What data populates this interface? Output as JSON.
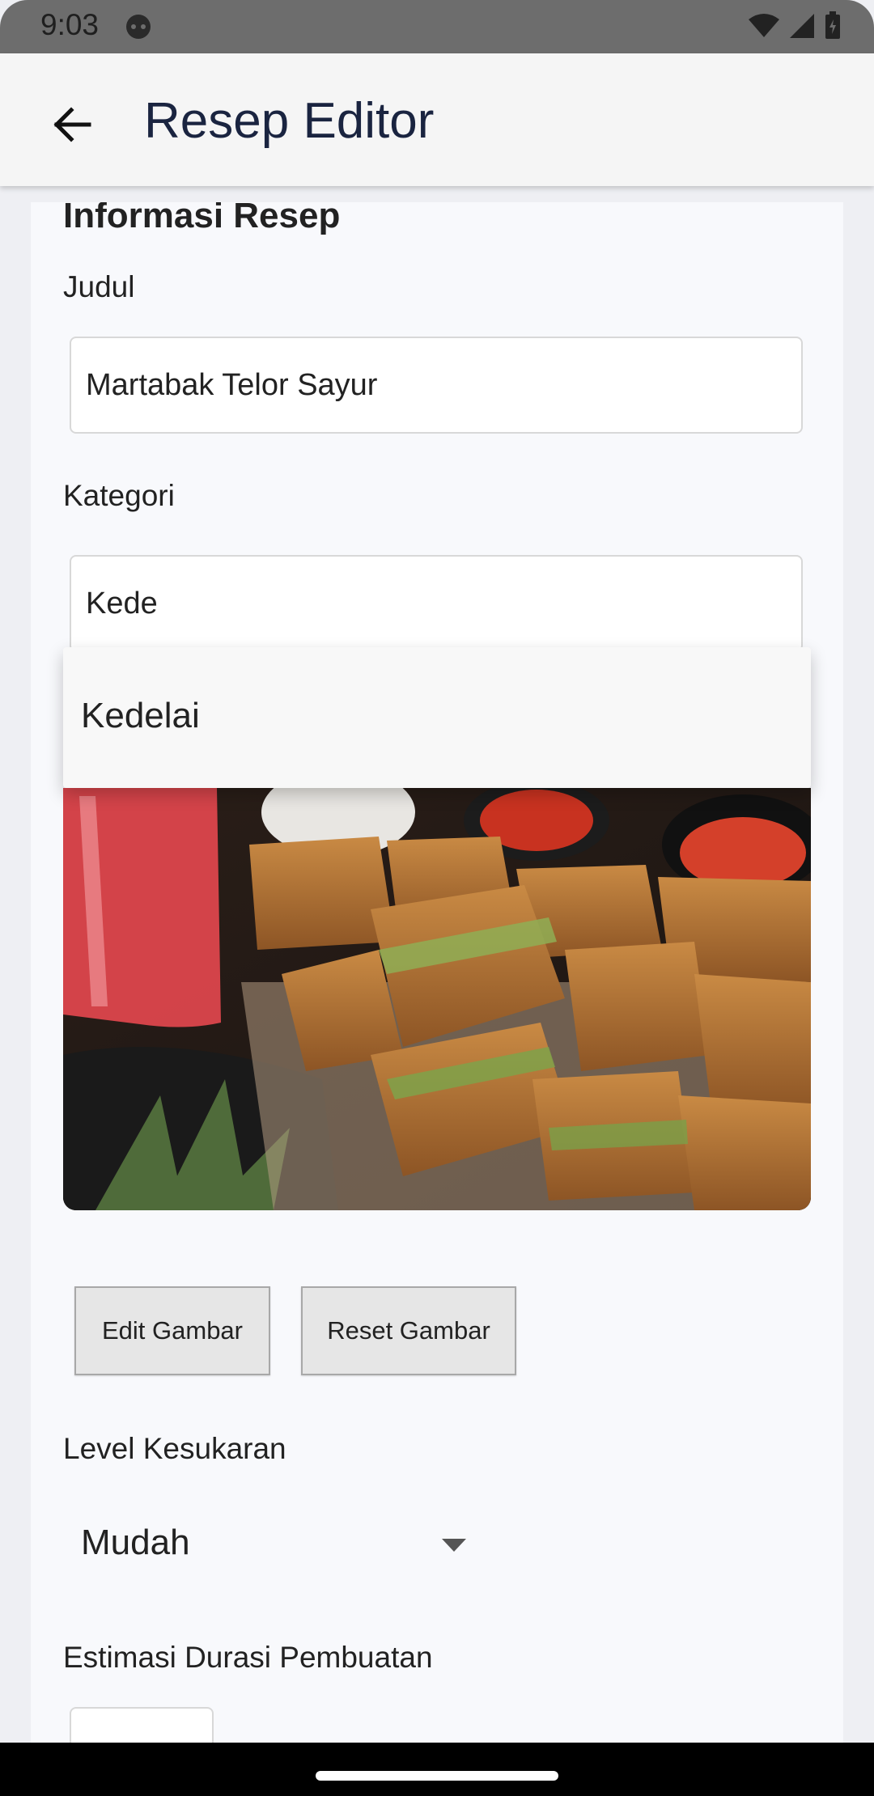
{
  "status_bar": {
    "time": "9:03",
    "icons": [
      "app-icon",
      "wifi-icon",
      "signal-icon",
      "battery-icon"
    ]
  },
  "app_bar": {
    "title": "Resep Editor",
    "back_icon": "arrow-left-icon"
  },
  "form": {
    "section_title": "Informasi Resep",
    "title_label": "Judul",
    "title_value": "Martabak Telor Sayur",
    "category_label": "Kategori",
    "category_value": "Kede",
    "category_suggestions": [
      "Kedelai"
    ],
    "image_alt": "Martabak telor sayur photo",
    "edit_image_label": "Edit Gambar",
    "reset_image_label": "Reset Gambar",
    "difficulty_label": "Level Kesukaran",
    "difficulty_value": "Mudah",
    "duration_label": "Estimasi Durasi Pembuatan"
  },
  "colors": {
    "app_bar_bg": "#f5f5f5",
    "title_color": "#1a2440",
    "card_bg": "#f8f9fc"
  }
}
